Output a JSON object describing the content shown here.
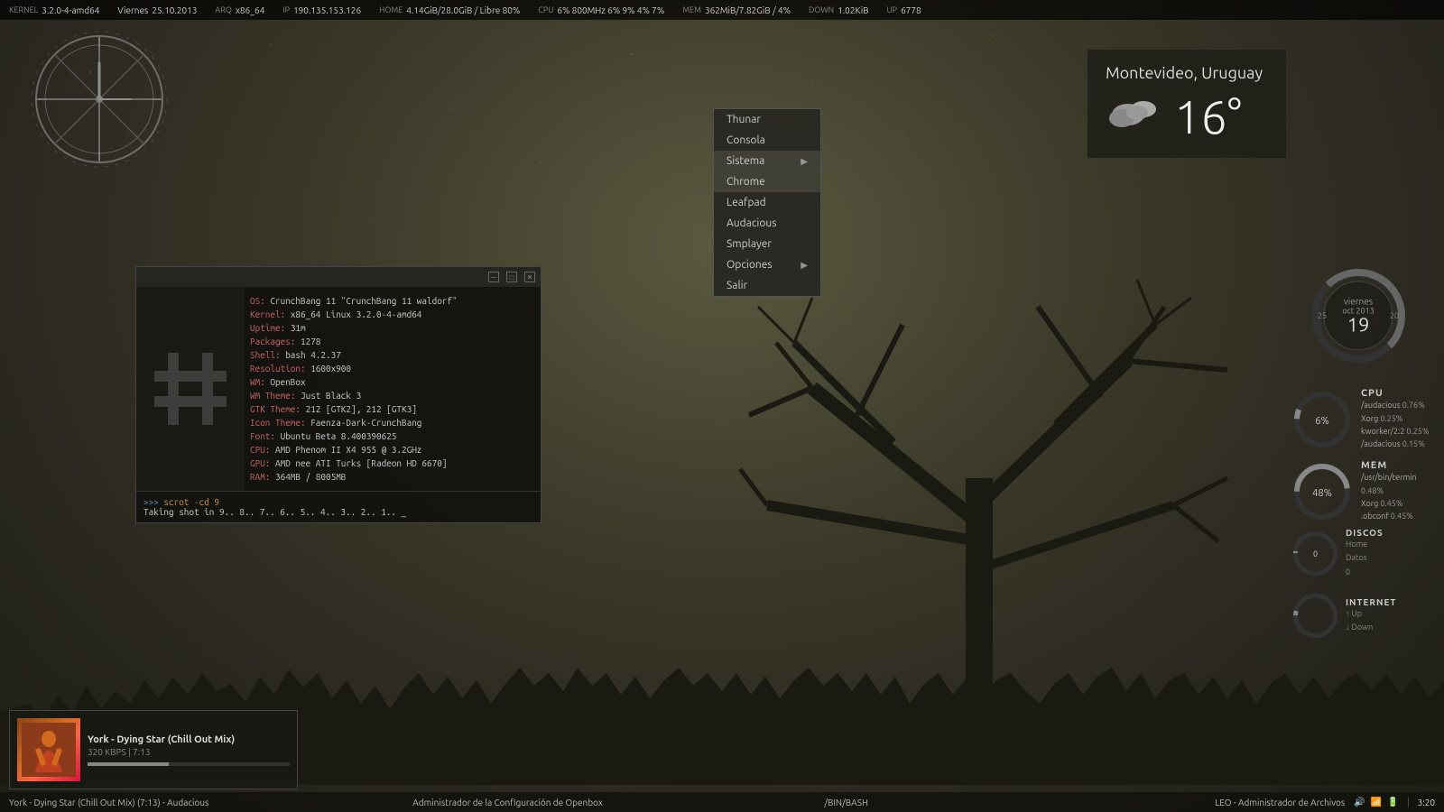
{
  "topbar": {
    "kernel_label": "Kernel",
    "kernel_value": "3.2.0-4-amd64",
    "day_label": "Viernes",
    "date_value": "25.10.2013",
    "arch_label": "Arq",
    "arch_value": "x86_64",
    "ip_label": "IP",
    "ip_value": "190.135.153.126",
    "home_label": "Home",
    "home_value": "4.14GiB/28.0GiB / Libre 80%",
    "cpu_label": "CPU",
    "cpu_value": "6% 800MHz 6% 9% 4% 7%",
    "mem_label": "Mem",
    "mem_value": "362MiB/7.82GiB / 4%",
    "down_label": "Down",
    "down_value": "1.02KiB",
    "up_label": "Up",
    "up_value": "6778"
  },
  "context_menu": {
    "items": [
      {
        "label": "Thunar",
        "has_arrow": false
      },
      {
        "label": "Consola",
        "has_arrow": false
      },
      {
        "label": "Sistema",
        "has_arrow": true
      },
      {
        "label": "Chrome",
        "has_arrow": false
      },
      {
        "label": "Leafpad",
        "has_arrow": false
      },
      {
        "label": "Audacious",
        "has_arrow": false
      },
      {
        "label": "Smplayer",
        "has_arrow": false
      },
      {
        "label": "Opciones",
        "has_arrow": true
      },
      {
        "label": "Salir",
        "has_arrow": false
      }
    ]
  },
  "terminal": {
    "title": "/bin/bash",
    "info": {
      "os_label": "OS:",
      "os_value": "CrunchBang 11 \"CrunchBang 11 waldorf\"",
      "kernel_label": "Kernel:",
      "kernel_value": "x86_64 Linux 3.2.0-4-amd64",
      "uptime_label": "Uptime:",
      "uptime_value": "31m",
      "packages_label": "Packages:",
      "packages_value": "1278",
      "shell_label": "Shell:",
      "shell_value": "bash 4.2.37",
      "resolution_label": "Resolution:",
      "resolution_value": "1600x900",
      "wm_label": "WM:",
      "wm_value": "OpenBox",
      "wm_theme_label": "WM Theme:",
      "wm_theme_value": "Just Black 3",
      "gtk_theme_label": "GTK Theme:",
      "gtk_theme_value": "212 [GTK2], 212 [GTK3]",
      "icon_theme_label": "Icon Theme:",
      "icon_theme_value": "Faenza-Dark-CrunchBang",
      "font_label": "Font:",
      "font_value": "Ubuntu Beta 8.400390625",
      "cpu_label": "CPU:",
      "cpu_value": "AMD Phenom II X4 955 @ 3.2GHz",
      "gpu_label": "GPU:",
      "gpu_value": "AMD nee ATI Turks [Radeon HD 6670]",
      "ram_label": "RAM:",
      "ram_value": "364MB / 8005MB"
    },
    "command": "scrot -cd 9",
    "output": "Taking shot in 9.. 8.. 7.. 6.. 5.. 4.. 3.. 2.. 1.. _"
  },
  "weather": {
    "city": "Montevideo, Uruguay",
    "temp": "16°",
    "condition": "cloudy"
  },
  "calendar": {
    "weekday": "viernes",
    "month": "oct 2013",
    "day": "19",
    "year": "2013",
    "prev": "25",
    "next": "20"
  },
  "cpu_widget": {
    "title": "CPU",
    "percent": 6,
    "processes": [
      {
        "name": "/audacious",
        "pct": "0.76%"
      },
      {
        "name": "Xorg",
        "pct": "0.25%"
      },
      {
        "name": "kworker/2:2",
        "pct": "0.25%"
      },
      {
        "name": "/audacious",
        "pct": "0.15%"
      }
    ]
  },
  "mem_widget": {
    "title": "MEM",
    "percent": 48,
    "processes": [
      {
        "name": "/usr/bin/termin",
        "pct": "0.48%"
      },
      {
        "name": "Xorg",
        "pct": "0.45%"
      },
      {
        "name": ".obconf",
        "pct": "0.45%"
      }
    ]
  },
  "discos_widget": {
    "title": "DISCOS",
    "items": [
      {
        "name": "Home",
        "pct": 0
      },
      {
        "name": "Datos",
        "pct": 0
      }
    ]
  },
  "internet_widget": {
    "title": "INTERNET",
    "up_label": "Up",
    "down_label": "Down"
  },
  "audacious": {
    "track": "York - Dying Star (Chill Out Mix)",
    "bitrate": "320 KBPS",
    "time": "7:13",
    "progress": 40
  },
  "taskbar": {
    "left": "York - Dying Star (Chill Out Mix) (7:13) - Audacious",
    "center": "Administrador de la Configuración de Openbox",
    "terminal": "/BIN/BASH",
    "right": "LEO - Administrador de Archivos",
    "time": "3:20"
  }
}
